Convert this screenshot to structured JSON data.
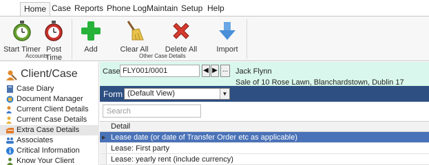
{
  "ribbon_tabs": [
    {
      "label": "Home",
      "active": true
    },
    {
      "label": "Case",
      "active": false
    },
    {
      "label": "Reports",
      "active": false
    },
    {
      "label": "Phone Log",
      "active": false
    },
    {
      "label": "Maintain",
      "active": false
    },
    {
      "label": "Setup",
      "active": false
    },
    {
      "label": "Help",
      "active": false
    }
  ],
  "ribbon": {
    "start_timer": "Start Timer",
    "post_time": "Post Time",
    "accounts_group": "Accounts",
    "add": "Add",
    "clear_all": "Clear All",
    "delete_all": "Delete All",
    "import": "Import",
    "other_case_details_group": "Other Case Details",
    "icons": {
      "start_timer": "stopwatch-green-icon",
      "post_time": "stopwatch-red-icon",
      "add": "plus-green-icon",
      "clear_all": "broom-icon",
      "delete_all": "red-x-icon",
      "import": "down-arrow-blue-icon"
    },
    "colors": {
      "green": "#6aa332",
      "red": "#c9342e",
      "blue": "#4a8fd8",
      "plus": "#27b23a"
    }
  },
  "nav": {
    "title": "Client/Case",
    "items": [
      {
        "label": "Case Diary",
        "icon": "diary-icon",
        "color": "#4b73b0"
      },
      {
        "label": "Document Manager",
        "icon": "document-manager-icon",
        "color": "#3a86c8"
      },
      {
        "label": "Current Client Details",
        "icon": "client-icon",
        "color": "#e08a2c"
      },
      {
        "label": "Current Case Details",
        "icon": "case-icon",
        "color": "#e8b23a"
      },
      {
        "label": "Extra Case Details",
        "icon": "extra-details-icon",
        "color": "#e07a2c",
        "selected": true
      },
      {
        "label": "Associates",
        "icon": "associates-icon",
        "color": "#3a7ac8"
      },
      {
        "label": "Critical Information",
        "icon": "info-icon",
        "color": "#2f7fd6"
      },
      {
        "label": "Know Your Client",
        "icon": "know-client-icon",
        "color": "#5a8a3a"
      }
    ]
  },
  "case_bar": {
    "label": "Case:",
    "case_number": "FLY001/0001",
    "prev": "◀",
    "next": "▶",
    "more": "...",
    "client_name": "Jack Flynn",
    "description": "Sale of 10 Rose Lawn, Blanchardstown, Dublin 17"
  },
  "form_bar": {
    "label": "Form",
    "selected_view": "(Default View)"
  },
  "search": {
    "placeholder": "Search"
  },
  "grid": {
    "column": "Detail",
    "rows": [
      {
        "detail": "Lease date (or date of Transfer Order etc as applicable)",
        "selected": true
      },
      {
        "detail": "Lease: First party",
        "selected": false
      },
      {
        "detail": "Lease: yearly rent (include currency)",
        "selected": false
      }
    ]
  }
}
